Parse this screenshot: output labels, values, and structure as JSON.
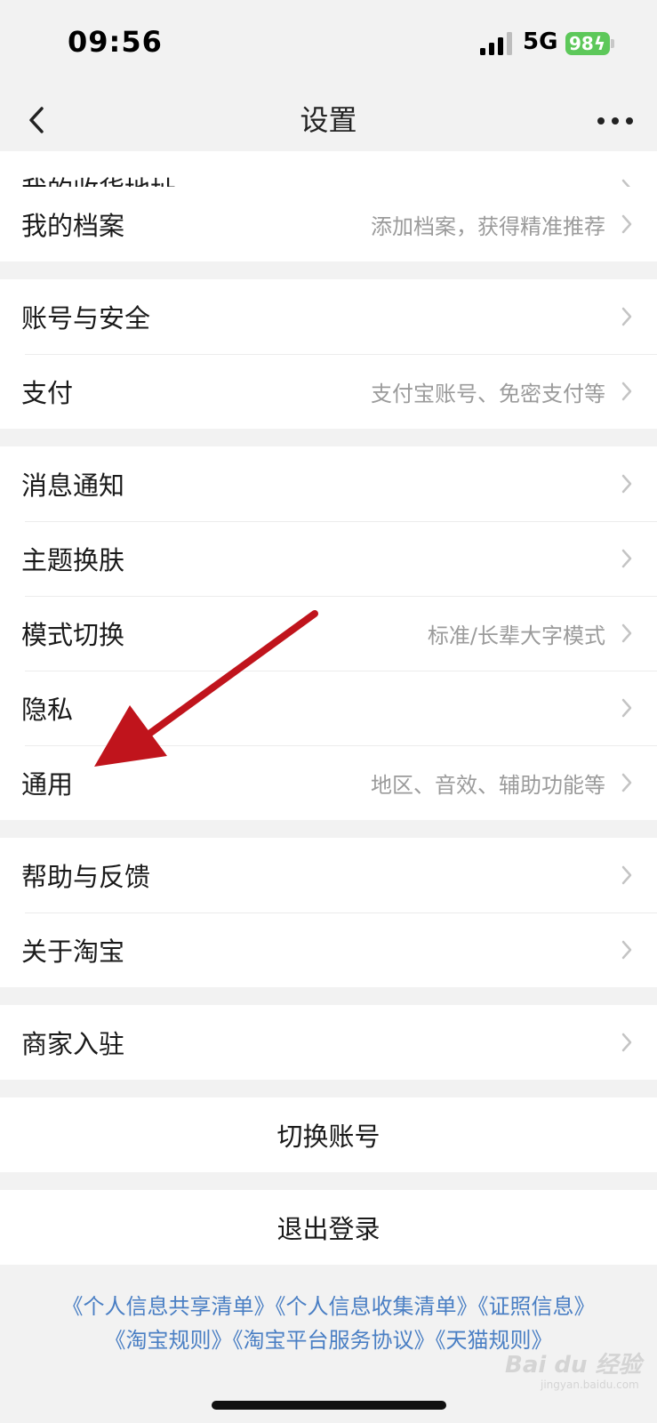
{
  "status_bar": {
    "time": "09:56",
    "network": "5G",
    "battery": "98"
  },
  "nav": {
    "title": "设置",
    "back_icon": "chevron-left-icon",
    "more_icon": "more-dots-icon"
  },
  "groups": [
    [
      {
        "label": "我的收货地址",
        "hint": "",
        "partial": true
      },
      {
        "label": "我的档案",
        "hint": "添加档案，获得精准推荐"
      }
    ],
    [
      {
        "label": "账号与安全",
        "hint": ""
      },
      {
        "label": "支付",
        "hint": "支付宝账号、免密支付等"
      }
    ],
    [
      {
        "label": "消息通知",
        "hint": ""
      },
      {
        "label": "主题换肤",
        "hint": ""
      },
      {
        "label": "模式切换",
        "hint": "标准/长辈大字模式"
      },
      {
        "label": "隐私",
        "hint": ""
      },
      {
        "label": "通用",
        "hint": "地区、音效、辅助功能等"
      }
    ],
    [
      {
        "label": "帮助与反馈",
        "hint": ""
      },
      {
        "label": "关于淘宝",
        "hint": ""
      }
    ],
    [
      {
        "label": "商家入驻",
        "hint": ""
      }
    ]
  ],
  "actions": {
    "switch_account": "切换账号",
    "logout": "退出登录"
  },
  "links": {
    "line1": [
      "《个人信息共享清单》",
      "《个人信息收集清单》",
      "《证照信息》"
    ],
    "line2": [
      "《淘宝规则》",
      "《淘宝平台服务协议》",
      "《天猫规则》"
    ]
  },
  "watermark": {
    "text": "Bai du 经验",
    "sub": "jingyan.baidu.com"
  },
  "colors": {
    "accent_link": "#4a7fc4",
    "annotation_arrow": "#c0141c",
    "battery": "#5dc85a"
  }
}
